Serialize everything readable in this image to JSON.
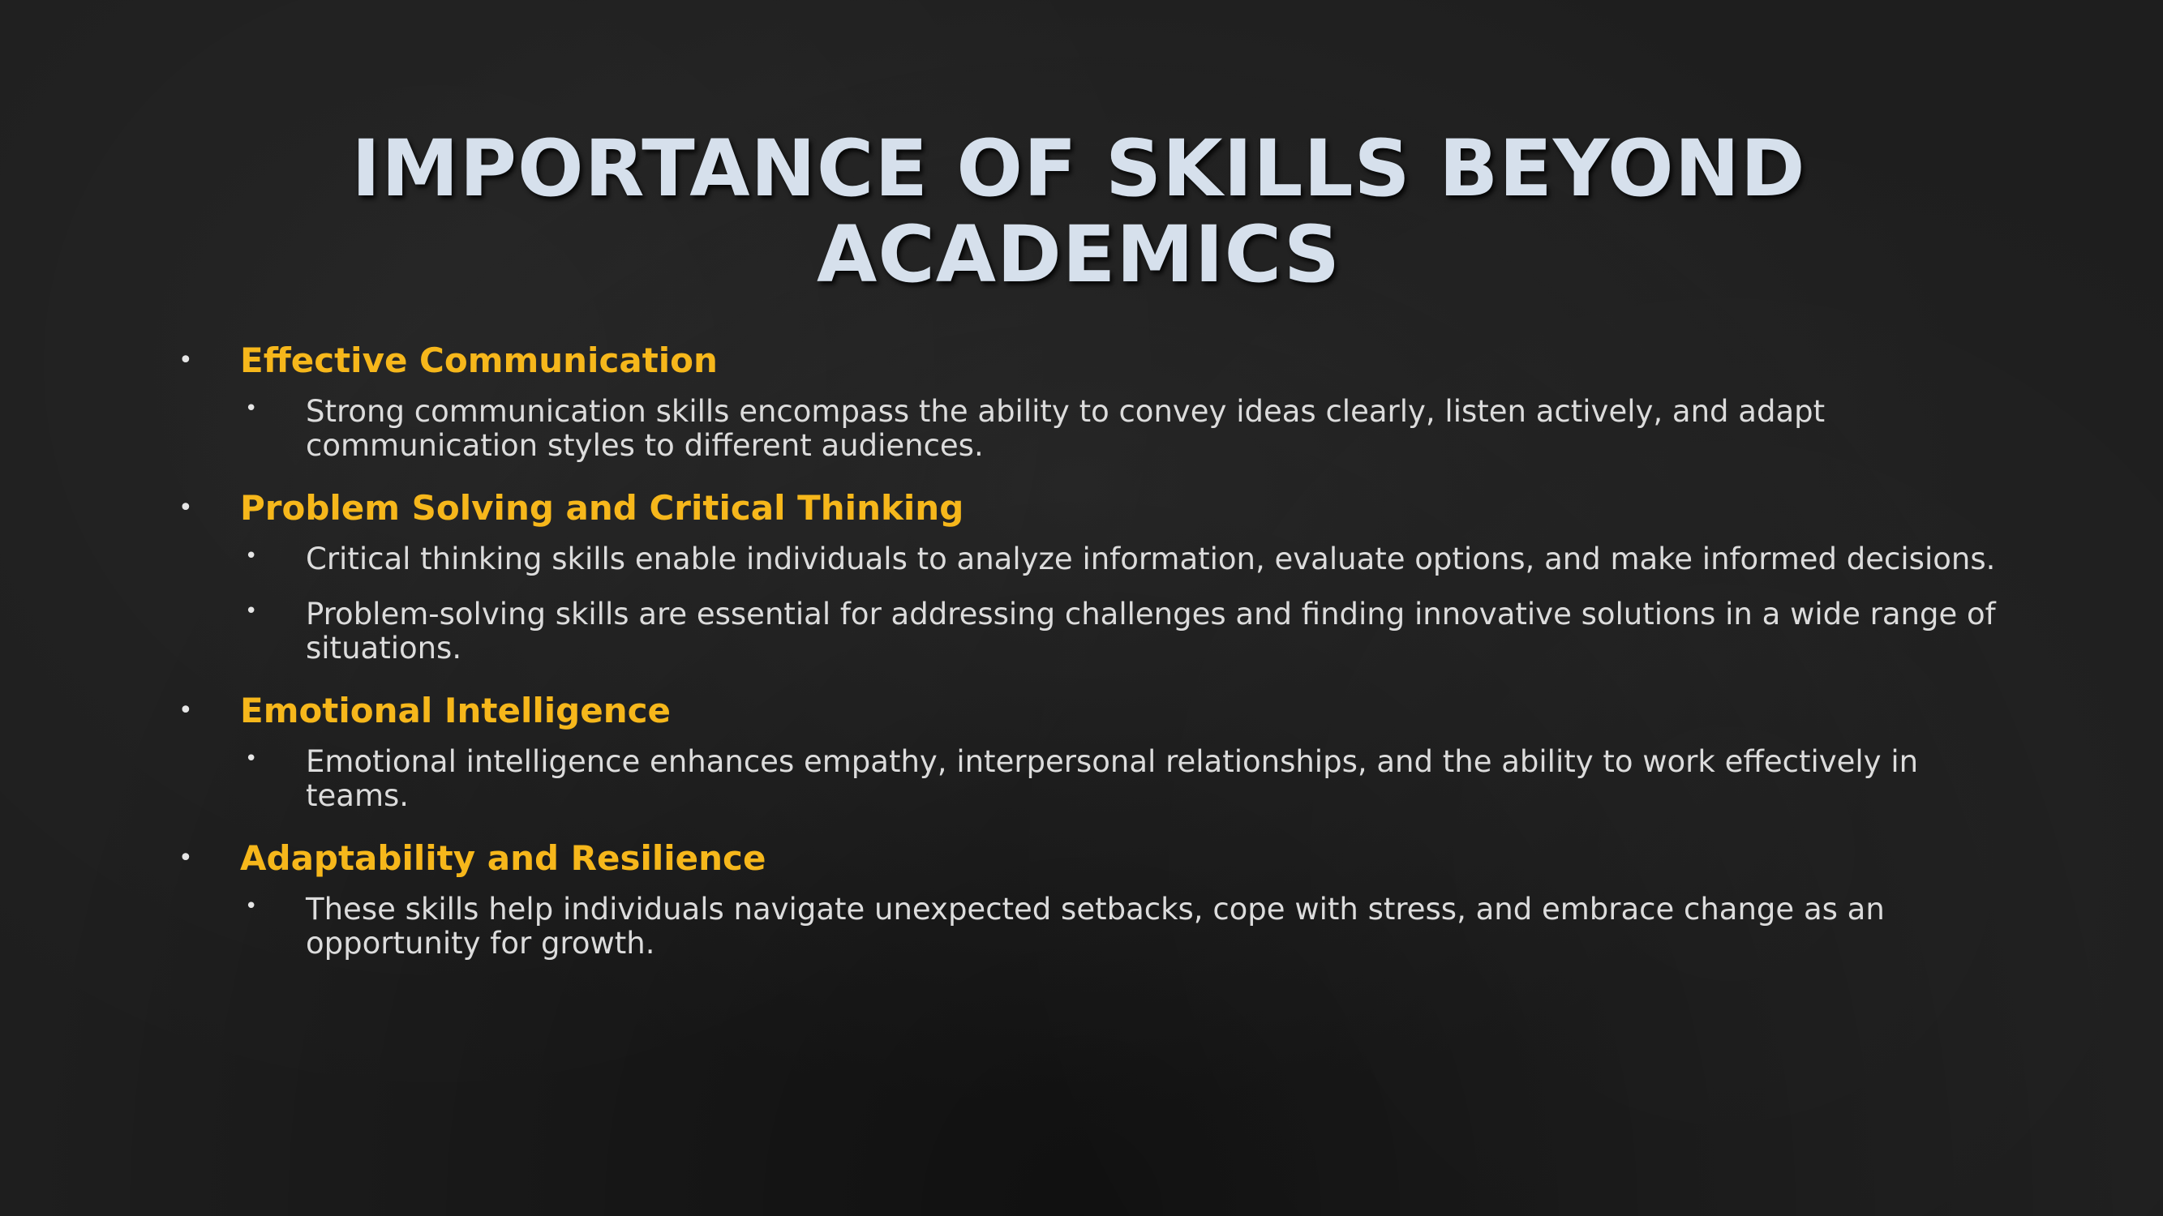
{
  "slide": {
    "title": "IMPORTANCE OF SKILLS BEYOND ACADEMICS",
    "bullet_glyph": "•",
    "sections": [
      {
        "heading": "Effective Communication",
        "points": [
          "Strong communication skills encompass the ability to convey ideas clearly, listen actively, and adapt communication styles to different audiences."
        ]
      },
      {
        "heading": "Problem Solving and Critical Thinking",
        "points": [
          "Critical thinking skills enable individuals to analyze information, evaluate options, and make informed decisions.",
          "Problem-solving skills are essential for addressing challenges and finding innovative solutions in a wide range of situations."
        ]
      },
      {
        "heading": "Emotional Intelligence",
        "points": [
          "Emotional intelligence enhances empathy, interpersonal relationships, and the ability to work effectively in teams."
        ]
      },
      {
        "heading": "Adaptability and Resilience",
        "points": [
          "These skills help individuals navigate unexpected setbacks, cope with stress, and embrace change as an opportunity for growth."
        ]
      }
    ]
  },
  "colors": {
    "title": "#d6e0ec",
    "heading": "#f6b71b",
    "body_text": "#dcdcdc",
    "background": "#1e1e1e"
  }
}
